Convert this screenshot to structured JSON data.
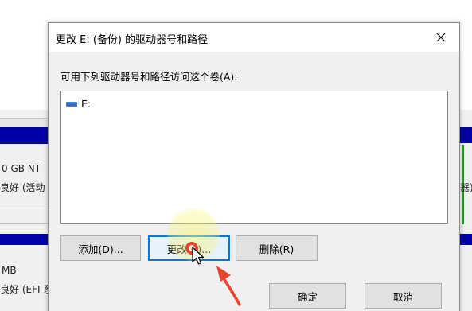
{
  "background": {
    "disk_info_line1": "0 GB NT",
    "disk_info_line2": "良好 (活动",
    "disk_info_line3": "MB",
    "disk_info_line4": "良好 (EFI 系",
    "right_info": "器)"
  },
  "dialog": {
    "title": "更改 E: (备份) 的驱动器号和路径",
    "prompt": "可用下列驱动器号和路径访问这个卷(A):",
    "list_items": [
      {
        "label": "E:",
        "icon": "drive-icon"
      }
    ],
    "buttons": {
      "add": "添加(D)...",
      "change": "更改(C)...",
      "remove": "删除(R)",
      "ok": "确定",
      "cancel": "取消"
    },
    "close_icon": "close-icon"
  },
  "colors": {
    "accent": "#0078d7",
    "annotation": "#e6442f",
    "volume_bar": "#0000a8"
  }
}
